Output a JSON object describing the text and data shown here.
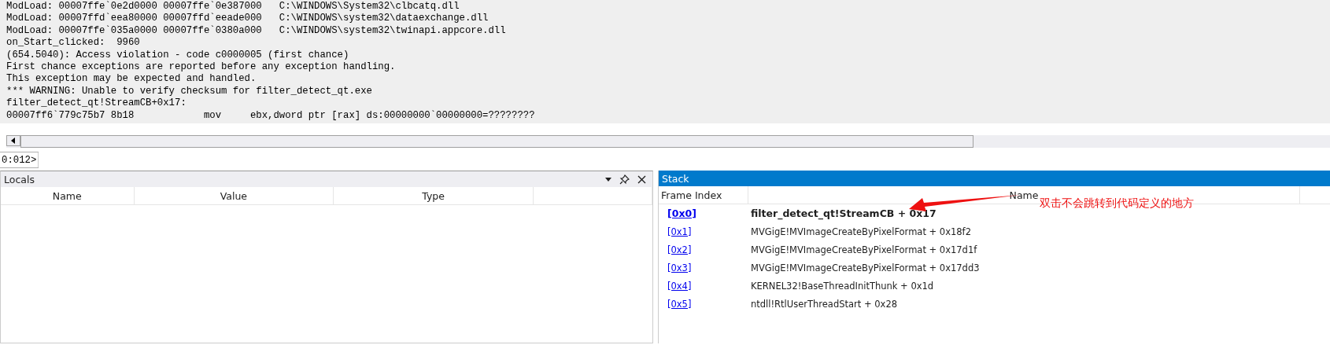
{
  "output_lines": [
    "ModLoad: 00007ffe`0e2d0000 00007ffe`0e387000   C:\\WINDOWS\\System32\\clbcatq.dll",
    "ModLoad: 00007ffd`eea80000 00007ffd`eeade000   C:\\WINDOWS\\system32\\dataexchange.dll",
    "ModLoad: 00007ffe`035a0000 00007ffe`0380a000   C:\\WINDOWS\\system32\\twinapi.appcore.dll",
    "on_Start_clicked:  9960",
    "(654.5040): Access violation - code c0000005 (first chance)",
    "First chance exceptions are reported before any exception handling.",
    "This exception may be expected and handled.",
    "*** WARNING: Unable to verify checksum for filter_detect_qt.exe",
    "filter_detect_qt!StreamCB+0x17:",
    "00007ff6`779c75b7 8b18            mov     ebx,dword ptr [rax] ds:00000000`00000000=????????"
  ],
  "command": {
    "prompt": "0:012>"
  },
  "locals": {
    "title": "Locals",
    "columns": [
      "Name",
      "Value",
      "Type"
    ]
  },
  "stack": {
    "title": "Stack",
    "columns": [
      "Frame Index",
      "Name"
    ],
    "frames": [
      {
        "index": "[0x0]",
        "name": "filter_detect_qt!StreamCB + 0x17",
        "current": true
      },
      {
        "index": "[0x1]",
        "name": "MVGigE!MVImageCreateByPixelFormat + 0x18f2",
        "current": false
      },
      {
        "index": "[0x2]",
        "name": "MVGigE!MVImageCreateByPixelFormat + 0x17d1f",
        "current": false
      },
      {
        "index": "[0x3]",
        "name": "MVGigE!MVImageCreateByPixelFormat + 0x17dd3",
        "current": false
      },
      {
        "index": "[0x4]",
        "name": "KERNEL32!BaseThreadInitThunk + 0x1d",
        "current": false
      },
      {
        "index": "[0x5]",
        "name": "ntdll!RtlUserThreadStart + 0x28",
        "current": false
      }
    ]
  },
  "annotation": {
    "text": "双击不会跳转到代码定义的地方"
  }
}
